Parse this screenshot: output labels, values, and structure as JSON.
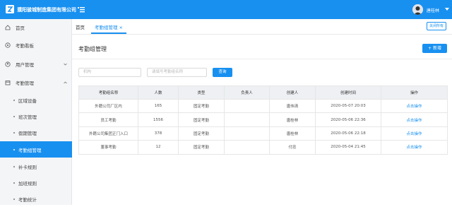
{
  "header": {
    "company": "濮阳骏城制造集团有限公司",
    "username": "唐桂林",
    "icons": {
      "logo": "logo-icon",
      "collapse": "collapse-menu-icon",
      "avatar": "avatar",
      "caret": "chevron-down-icon"
    },
    "colors": {
      "brand": "#1890f0"
    }
  },
  "sidebar": {
    "items": [
      {
        "label": "首页",
        "icon": "home-icon"
      },
      {
        "label": "考勤看板",
        "icon": "dashboard-icon"
      },
      {
        "label": "用户管理",
        "icon": "user-icon"
      },
      {
        "label": "考勤管理",
        "icon": "calendar-icon"
      }
    ],
    "subitems": [
      {
        "label": "区域设备"
      },
      {
        "label": "班次管理"
      },
      {
        "label": "假期管理"
      },
      {
        "label": "考勤组管理",
        "active": true
      },
      {
        "label": "补卡规则"
      },
      {
        "label": "加班规则"
      },
      {
        "label": "考勤统计"
      }
    ]
  },
  "tabs": {
    "home": "首页",
    "active": "考勤组管理",
    "close_glyph": "×",
    "close_all": "关闭所有"
  },
  "main": {
    "title": "考勤组管理",
    "add_button": "+ 新增",
    "search": {
      "placeholder1": "机构",
      "placeholder2": "请填写考勤组名称",
      "query_button": "查询"
    },
    "table": {
      "headers": [
        "考勤组名称",
        "人数",
        "类型",
        "负责人",
        "创建人",
        "创建时间",
        "操作"
      ],
      "rows": [
        [
          "外籍公司厂区内",
          "165",
          "固定考勤",
          "",
          "唐伟清",
          "2020-05-07 20:03",
          "点击操作"
        ],
        [
          "员工考勤",
          "1556",
          "固定考勤",
          "",
          "唐桂林",
          "2020-05-06 22:36",
          "点击操作"
        ],
        [
          "外籍公司集团正门入口",
          "378",
          "固定考勤",
          "",
          "唐桂林",
          "2020-05-06 22:18",
          "点击操作"
        ],
        [
          "董事考勤",
          "12",
          "固定考勤",
          "",
          "付忠",
          "2020-05-04 21:45",
          "点击操作"
        ]
      ]
    }
  }
}
